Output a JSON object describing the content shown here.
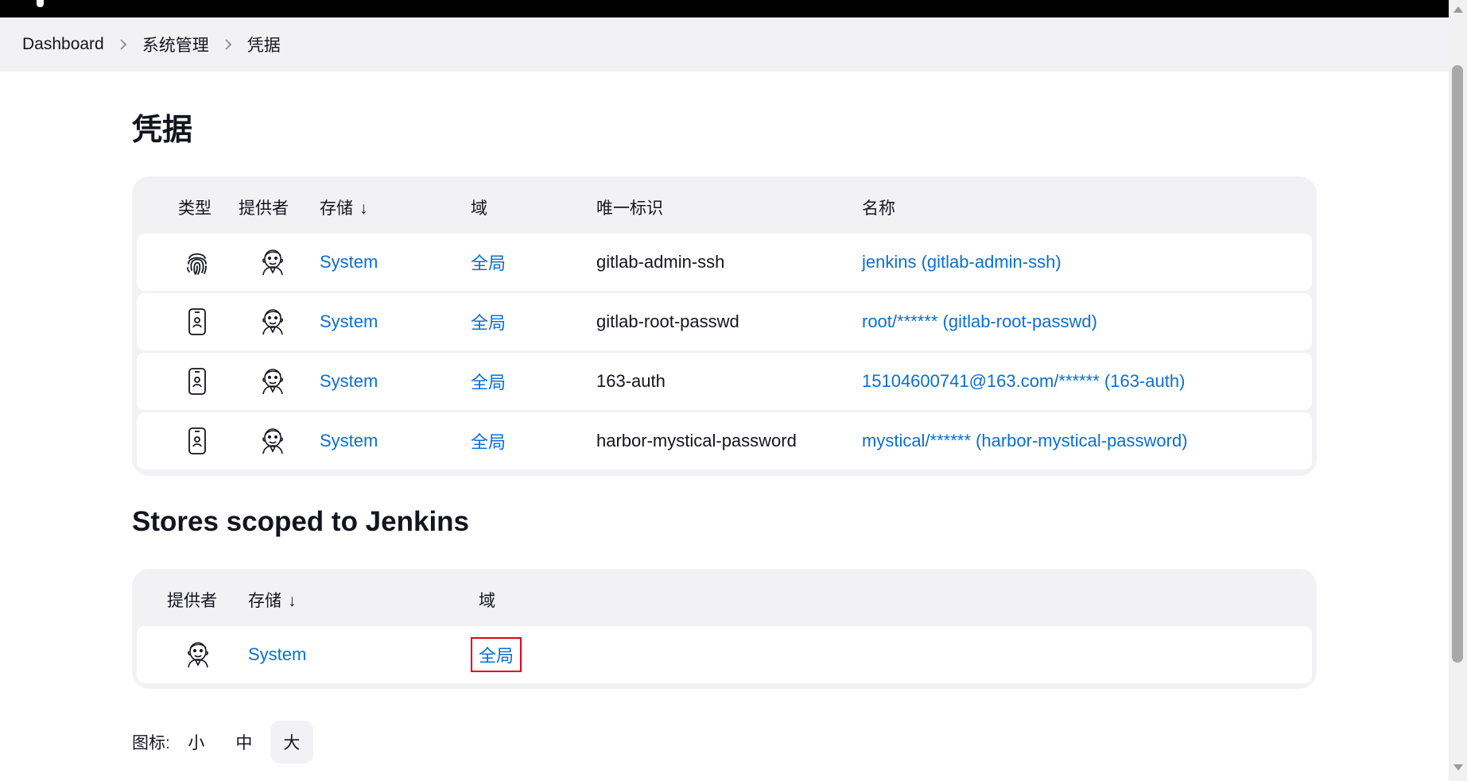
{
  "breadcrumb": [
    "Dashboard",
    "系统管理",
    "凭据"
  ],
  "page_title": "凭据",
  "credentials_table": {
    "columns": {
      "type": "类型",
      "provider": "提供者",
      "store": "存储",
      "store_sort": "↓",
      "domain": "域",
      "id": "唯一标识",
      "name": "名称"
    },
    "rows": [
      {
        "type_icon": "fingerprint-icon",
        "provider_icon": "jenkins-icon",
        "store": "System",
        "domain": "全局",
        "id": "gitlab-admin-ssh",
        "name": "jenkins (gitlab-admin-ssh)"
      },
      {
        "type_icon": "phone-badge-icon",
        "provider_icon": "jenkins-icon",
        "store": "System",
        "domain": "全局",
        "id": "gitlab-root-passwd",
        "name": "root/****** (gitlab-root-passwd)"
      },
      {
        "type_icon": "phone-badge-icon",
        "provider_icon": "jenkins-icon",
        "store": "System",
        "domain": "全局",
        "id": "163-auth",
        "name": "15104600741@163.com/****** (163-auth)"
      },
      {
        "type_icon": "phone-badge-icon",
        "provider_icon": "jenkins-icon",
        "store": "System",
        "domain": "全局",
        "id": "harbor-mystical-password",
        "name": "mystical/****** (harbor-mystical-password)"
      }
    ]
  },
  "stores_section": {
    "title": "Stores scoped to Jenkins",
    "columns": {
      "provider": "提供者",
      "store": "存储",
      "store_sort": "↓",
      "domain": "域"
    },
    "rows": [
      {
        "provider_icon": "jenkins-icon",
        "store": "System",
        "domain": "全局",
        "highlighted": true
      }
    ]
  },
  "icon_size": {
    "label": "图标:",
    "options": [
      "小",
      "中",
      "大"
    ],
    "selected": "大"
  },
  "colors": {
    "link": "#0b6fd1",
    "highlight": "#e3001b",
    "panel": "#f2f2f5"
  }
}
